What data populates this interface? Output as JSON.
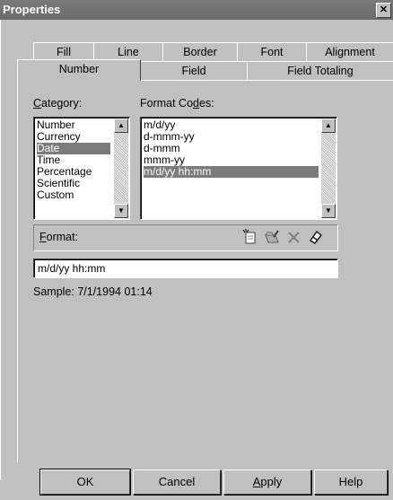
{
  "window": {
    "title": "Properties",
    "close_symbol": "✕"
  },
  "tabs": {
    "back_row": [
      "Fill",
      "Line",
      "Border",
      "Font",
      "Alignment"
    ],
    "front_row": [
      "Number",
      "Field",
      "Field Totaling"
    ],
    "active": "Number"
  },
  "category": {
    "label_u": "C",
    "label_rest": "ategory:",
    "items": [
      "Number",
      "Currency",
      "Date",
      "Time",
      "Percentage",
      "Scientific",
      "Custom"
    ],
    "selected": "Date"
  },
  "format_codes": {
    "label_pre": "Format Co",
    "label_u": "d",
    "label_rest": "es:",
    "items": [
      "m/d/yy",
      "d-mmm-yy",
      "d-mmm",
      "mmm-yy",
      "m/d/yy hh:mm"
    ],
    "selected": "m/d/yy hh:mm"
  },
  "format": {
    "label_u": "F",
    "label_rest": "ormat:",
    "value": "m/d/yy hh:mm",
    "toolbar_icons": [
      "add-format-icon",
      "edit-format-icon",
      "delete-format-icon",
      "clear-format-icon"
    ]
  },
  "sample": {
    "text": "Sample:  7/1/1994 01:14"
  },
  "buttons": {
    "ok": "OK",
    "cancel": "Cancel",
    "apply_u": "A",
    "apply_rest": "pply",
    "help": "Help"
  }
}
